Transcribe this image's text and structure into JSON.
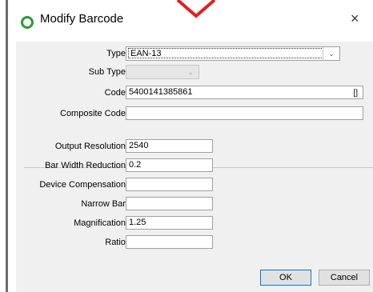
{
  "window": {
    "title": "Modify Barcode",
    "close_glyph": "×"
  },
  "form": {
    "type": {
      "label": "Type:",
      "value": "EAN-13"
    },
    "sub_type": {
      "label": "Sub Type:",
      "value": ""
    },
    "code": {
      "label": "Code:",
      "value": "5400141385861",
      "button": "[]"
    },
    "composite_code": {
      "label": "Composite Code:",
      "value": ""
    },
    "output_resolution": {
      "label": "Output Resolution:",
      "value": "2540"
    },
    "bar_width_reduction": {
      "label": "Bar Width Reduction:",
      "value": "0.2"
    },
    "device_compensation": {
      "label": "Device Compensation:",
      "value": ""
    },
    "narrow_bar": {
      "label": "Narrow Bar:",
      "value": ""
    },
    "magnification": {
      "label": "Magnification:",
      "value": "1.25"
    },
    "ratio": {
      "label": "Ratio:",
      "value": ""
    }
  },
  "buttons": {
    "ok": "OK",
    "cancel": "Cancel"
  },
  "icons": {
    "title_icon": "status-circle-icon",
    "dropdown": "chevron-down-icon",
    "annotation": "red-arrow-marker"
  },
  "colors": {
    "title_icon": "#2e9a3c",
    "annotation": "#e02020",
    "dialog_body": "#f0f0f0"
  }
}
